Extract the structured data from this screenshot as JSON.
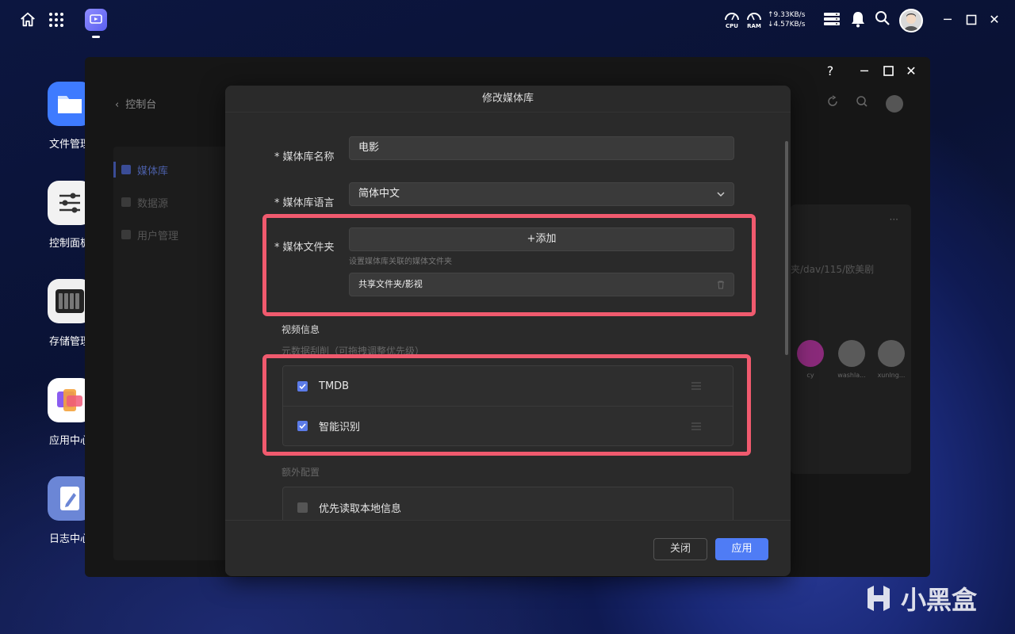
{
  "topbar": {
    "cpu_label": "CPU",
    "ram_label": "RAM",
    "net_up": "↑9.33KB/s",
    "net_down": "↓4.57KB/s"
  },
  "desktop": {
    "items": [
      {
        "label": "文件管理"
      },
      {
        "label": "控制面板"
      },
      {
        "label": "存储管理"
      },
      {
        "label": "应用中心"
      },
      {
        "label": "日志中心"
      }
    ]
  },
  "window": {
    "back_label": "控制台",
    "help": "?",
    "sidebar": [
      {
        "label": "媒体库"
      },
      {
        "label": "数据源"
      },
      {
        "label": "用户管理"
      }
    ],
    "bg_path": "夹/dav/115/欧美剧",
    "bg_more": "···",
    "bg_users": [
      {
        "name": "cy"
      },
      {
        "name": "washla..."
      },
      {
        "name": "xunlng..."
      }
    ]
  },
  "modal": {
    "title": "修改媒体库",
    "name_label": "媒体库名称",
    "name_value": "电影",
    "lang_label": "媒体库语言",
    "lang_value": "简体中文",
    "folder_label": "媒体文件夹",
    "add_label": "+添加",
    "folder_hint": "设置媒体库关联的媒体文件夹",
    "folder_path": "共享文件夹/影视",
    "video_info_title": "视频信息",
    "scrape_subtitle": "元数据刮削（可拖拽调整优先级）",
    "scrapers": [
      {
        "label": "TMDB",
        "checked": true
      },
      {
        "label": "智能识别",
        "checked": true
      }
    ],
    "extra_title": "额外配置",
    "extra_options": [
      {
        "label": "优先读取本地信息",
        "checked": false
      }
    ],
    "close_label": "关闭",
    "apply_label": "应用"
  },
  "watermark": "小黑盒",
  "colors": {
    "accent": "#4f7cf5",
    "highlight": "#f05a6e",
    "modal_bg": "#2a2a2a"
  }
}
